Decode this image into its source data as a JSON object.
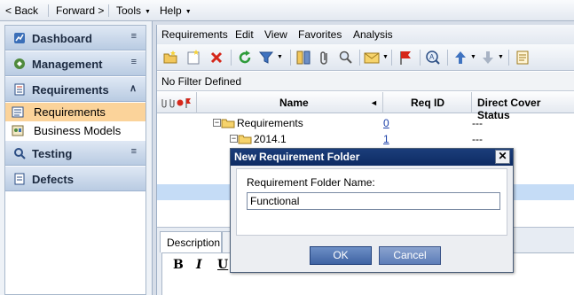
{
  "topbar": {
    "back": "Back",
    "forward": "Forward",
    "tools": "Tools",
    "help": "Help"
  },
  "sidebar": {
    "groups": [
      {
        "label": "Dashboard",
        "chevron": "double-down",
        "icon": "dashboard-icon"
      },
      {
        "label": "Management",
        "chevron": "double-down",
        "icon": "management-icon"
      },
      {
        "label": "Requirements",
        "chevron": "double-up",
        "icon": "requirements-icon"
      },
      {
        "label": "Testing",
        "chevron": "double-down",
        "icon": "testing-icon"
      },
      {
        "label": "Defects",
        "chevron": "",
        "icon": "defects-icon"
      }
    ],
    "sub_items": [
      {
        "label": "Requirements",
        "selected": true
      },
      {
        "label": "Business Models",
        "selected": false
      }
    ]
  },
  "module_menu": {
    "items": [
      "Requirements",
      "Edit",
      "View",
      "Favorites",
      "Analysis"
    ]
  },
  "filter": {
    "text": "No Filter Defined"
  },
  "grid": {
    "columns": [
      "Name",
      "Req ID",
      "Direct Cover Status"
    ],
    "rows": [
      {
        "name": "Requirements",
        "req_id": "0",
        "status": "---"
      },
      {
        "name": "2014.1",
        "req_id": "1",
        "status": "---"
      }
    ]
  },
  "details": {
    "tab_label": "Description",
    "editor_buttons": [
      "B",
      "I",
      "U"
    ]
  },
  "dialog": {
    "title": "New Requirement Folder",
    "close": "✕",
    "field_label": "Requirement Folder Name:",
    "field_value": "Functional",
    "ok_label": "OK",
    "cancel_label": "Cancel"
  },
  "colors": {
    "accent": "#0d2b63",
    "selected_nav": "#fbd39a",
    "row_highlight": "#c5dcf6"
  }
}
